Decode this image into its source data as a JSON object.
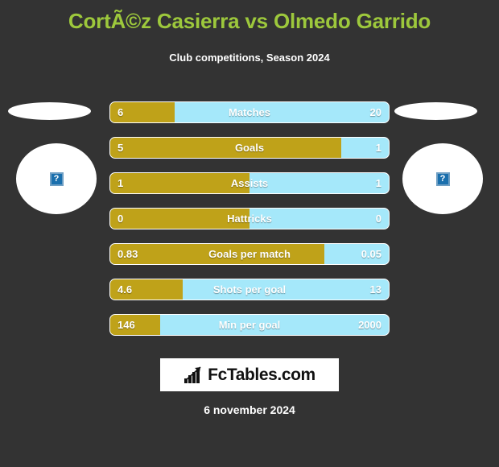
{
  "header": {
    "title": "CortÃ©z Casierra vs Olmedo Garrido",
    "subtitle": "Club competitions, Season 2024"
  },
  "players": {
    "left": {
      "photo_alt": "broken-image",
      "placeholder_glyph": "?"
    },
    "right": {
      "photo_alt": "broken-image",
      "placeholder_glyph": "?"
    }
  },
  "footer": {
    "logo_text": "FcTables.com",
    "logo_icon": "bar-chart-arrow-icon",
    "date": "6 november 2024"
  },
  "colors": {
    "background": "#333333",
    "title": "#9dc83c",
    "left_player": "#bfa219",
    "right_player": "#a5e8fa",
    "text": "#ffffff"
  },
  "chart_data": {
    "type": "bar",
    "title": "CortÃ©z Casierra vs Olmedo Garrido",
    "subtitle": "Club competitions, Season 2024",
    "orientation": "horizontal-diverging",
    "legend": [
      "CortÃ©z Casierra",
      "Olmedo Garrido"
    ],
    "categories": [
      "Matches",
      "Goals",
      "Assists",
      "Hattricks",
      "Goals per match",
      "Shots per goal",
      "Min per goal"
    ],
    "series": [
      {
        "name": "CortÃ©z Casierra",
        "color": "#bfa219",
        "values": [
          "6",
          "5",
          "1",
          "0",
          "0.83",
          "4.6",
          "146"
        ]
      },
      {
        "name": "Olmedo Garrido",
        "color": "#a5e8fa",
        "values": [
          "20",
          "1",
          "1",
          "0",
          "0.05",
          "13",
          "2000"
        ]
      }
    ],
    "rows": [
      {
        "label": "Matches",
        "left": "6",
        "right": "20",
        "left_pct": 23
      },
      {
        "label": "Goals",
        "left": "5",
        "right": "1",
        "left_pct": 83
      },
      {
        "label": "Assists",
        "left": "1",
        "right": "1",
        "left_pct": 50
      },
      {
        "label": "Hattricks",
        "left": "0",
        "right": "0",
        "left_pct": 50
      },
      {
        "label": "Goals per match",
        "left": "0.83",
        "right": "0.05",
        "left_pct": 77
      },
      {
        "label": "Shots per goal",
        "left": "4.6",
        "right": "13",
        "left_pct": 26
      },
      {
        "label": "Min per goal",
        "left": "146",
        "right": "2000",
        "left_pct": 18
      }
    ]
  }
}
